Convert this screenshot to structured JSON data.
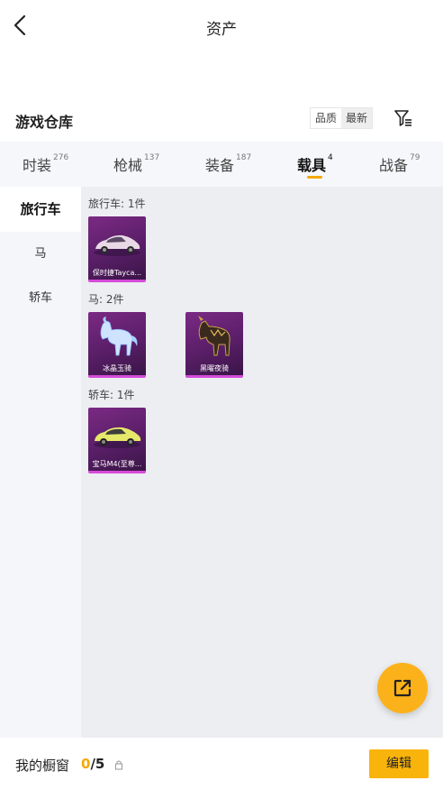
{
  "header": {
    "title": "资产"
  },
  "section": {
    "title": "游戏仓库",
    "sort_options": [
      "品质",
      "最新"
    ]
  },
  "tabs": [
    {
      "label": "时装",
      "count": "276"
    },
    {
      "label": "枪械",
      "count": "137"
    },
    {
      "label": "装备",
      "count": "187"
    },
    {
      "label": "载具",
      "count": "4"
    },
    {
      "label": "战备",
      "count": "79"
    }
  ],
  "active_tab": "载具",
  "sidebar": {
    "items": [
      {
        "label": "旅行车"
      },
      {
        "label": "马"
      },
      {
        "label": "轿车"
      }
    ]
  },
  "groups": [
    {
      "label": "旅行车: 1件",
      "items": [
        {
          "name": "保时捷Tayca..."
        }
      ]
    },
    {
      "label": "马: 2件",
      "items": [
        {
          "name": "冰晶玉骑"
        },
        {
          "name": "黑曜夜骑"
        }
      ]
    },
    {
      "label": "轿车: 1件",
      "items": [
        {
          "name": "宝马M4(至尊..."
        }
      ]
    }
  ],
  "footer": {
    "window_label": "我的橱窗",
    "current": "0",
    "total": "/5",
    "edit_label": "编辑"
  },
  "colors": {
    "accent": "#f5a800",
    "card_bg": "#5c1f6a",
    "card_border": "#d64bd9",
    "fab": "#fbb21a"
  },
  "icons": {
    "back": "chevron-left-icon",
    "filter": "filter-icon",
    "share": "external-link-icon",
    "lock": "lock-icon"
  }
}
